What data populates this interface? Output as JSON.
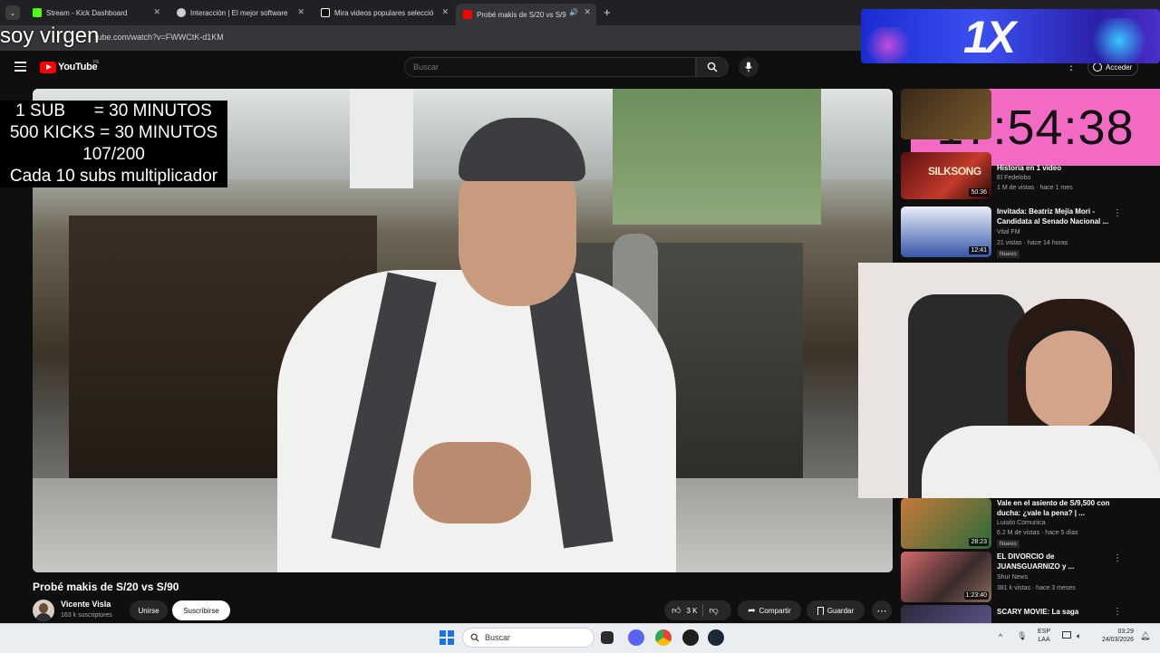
{
  "browser": {
    "tabs": [
      {
        "label": "Stream - Kick Dashboard",
        "color": "#53fc18"
      },
      {
        "label": "Interacción | El mejor software",
        "color": "#cfcfcf"
      },
      {
        "label": "Mira videos populares selecció",
        "color": "#ffffff"
      },
      {
        "label": "Probé makis de S/20 vs S/9",
        "color": "#ff0000"
      }
    ],
    "url": "tube.com/watch?v=FWWCtK-d1KM"
  },
  "youtube": {
    "logo_text": "YouTube",
    "country_code": "PE",
    "search_placeholder": "Buscar",
    "signin_label": "Acceder"
  },
  "overlays": {
    "top_text": "soy virgen",
    "goal_lines": [
      "1 SUB      = 30 MINUTOS",
      "500 KICKS = 30 MINUTOS",
      "107/200",
      "Cada 10 subs multiplicador"
    ],
    "brand": "1X",
    "clock": "17:54:38"
  },
  "video": {
    "title": "Probé makis de S/20 vs S/90",
    "channel": "Vicente Visla",
    "subscribers": "163 k suscriptores",
    "join_label": "Unirse",
    "subscribe_label": "Suscribirse",
    "likes": "3 K",
    "share_label": "Compartir",
    "save_label": "Guardar"
  },
  "recommendations": [
    {
      "title": "Historia en 1 video",
      "channel": "El Fedelobo",
      "meta": "1 M de vistas · hace 1 mes",
      "duration": "50:36",
      "badge": ""
    },
    {
      "title": "Invitada: Beatriz Mejía Mori - Candidata al Senado Nacional ...",
      "channel": "Vital FM",
      "meta": "21 vistas · hace 14 horas",
      "duration": "12:41",
      "badge": "Nuevo"
    },
    {
      "title": "Vale en el asiento de S/9,500 con ducha: ¿vale la pena? | ...",
      "channel": "Luisito Comunica",
      "meta": "6.2 M de vistas · hace 5 días",
      "duration": "28:23",
      "badge": "Nuevo"
    },
    {
      "title": "EL DIVORCIO de JUANSGUARNIZO y ...",
      "channel": "Shur News",
      "meta": "381 k vistas · hace 3 meses",
      "duration": "1:23:40",
      "badge": ""
    },
    {
      "title": "SCARY MOVIE: La saga",
      "channel": "",
      "meta": "",
      "duration": "",
      "badge": ""
    }
  ],
  "taskbar": {
    "search_label": "Buscar",
    "lang_line1": "ESP",
    "lang_line2": "LAA",
    "time": "03:29",
    "date": "24/03/2026"
  }
}
